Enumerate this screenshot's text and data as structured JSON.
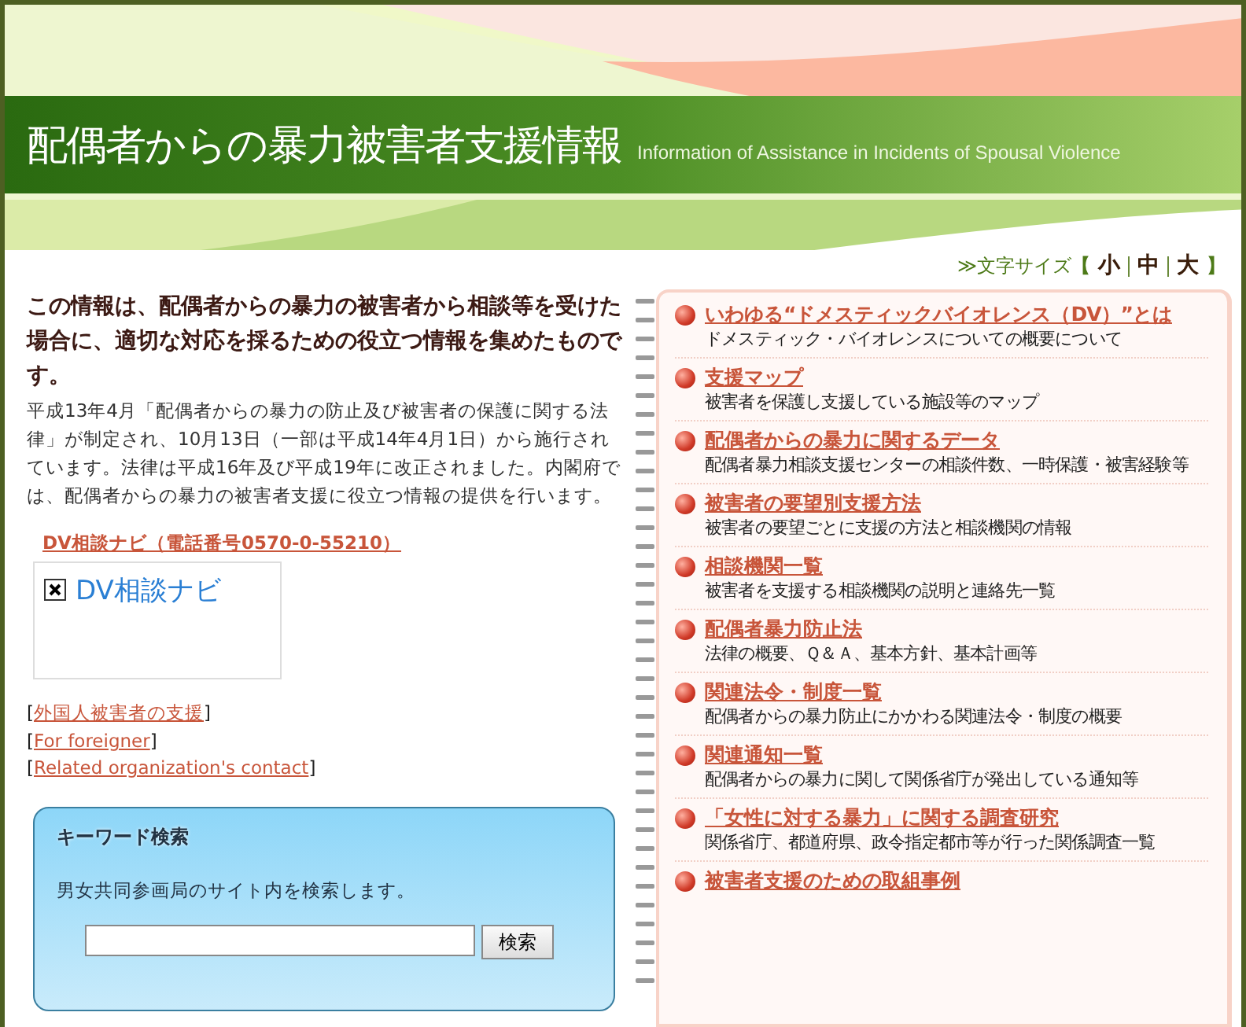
{
  "header": {
    "title": "配偶者からの暴力被害者支援情報",
    "subtitle": "Information of Assistance in Incidents of Spousal Violence"
  },
  "font_size": {
    "label": "≫文字サイズ",
    "open": "【",
    "close": "】",
    "sizes": [
      {
        "label": "小"
      },
      {
        "label": "中"
      },
      {
        "label": "大"
      }
    ]
  },
  "intro": {
    "heading": "この情報は、配偶者からの暴力の被害者から相談等を受けた場合に、適切な対応を採るための役立つ情報を集めたものです。",
    "body": "平成13年4月「配偶者からの暴力の防止及び被害者の保護に関する法律」が制定され、10月13日（一部は平成14年4月1日）から施行されています。法律は平成16年及び平成19年に改正されました。内閣府では、配偶者からの暴力の被害者支援に役立つ情報の提供を行います。"
  },
  "navi_link": "DV相談ナビ（電話番号0570-0-55210）",
  "navi_image": {
    "alt": "DV相談ナビ"
  },
  "links": [
    {
      "open": "[",
      "label": "外国人被害者の支援",
      "close": "]"
    },
    {
      "open": "[",
      "label": "For foreigner",
      "close": "]"
    },
    {
      "open": "[",
      "label": "Related organization's contact",
      "close": "]"
    }
  ],
  "search": {
    "title": "キーワード検索",
    "description": "男女共同参画局のサイト内を検索します。",
    "button": "検索"
  },
  "menu": [
    {
      "title": "いわゆる“ドメスティックバイオレンス（DV）”とは",
      "description": "ドメスティック・バイオレンスについての概要について"
    },
    {
      "title": "支援マップ",
      "description": "被害者を保護し支援している施設等のマップ"
    },
    {
      "title": "配偶者からの暴力に関するデータ",
      "description": "配偶者暴力相談支援センターの相談件数、一時保護・被害経験等"
    },
    {
      "title": "被害者の要望別支援方法",
      "description": "被害者の要望ごとに支援の方法と相談機関の情報"
    },
    {
      "title": "相談機関一覧",
      "description": "被害者を支援する相談機関の説明と連絡先一覧"
    },
    {
      "title": "配偶者暴力防止法",
      "description": "法律の概要、Ｑ＆Ａ、基本方針、基本計画等"
    },
    {
      "title": "関連法令・制度一覧",
      "description": "配偶者からの暴力防止にかかわる関連法令・制度の概要"
    },
    {
      "title": "関連通知一覧",
      "description": "配偶者からの暴力に関して関係省庁が発出している通知等"
    },
    {
      "title": "「女性に対する暴力」に関する調査研究",
      "description": "関係省庁、都道府県、政令指定都市等が行った関係調査一覧"
    },
    {
      "title": "被害者支援のための取組事例"
    }
  ]
}
